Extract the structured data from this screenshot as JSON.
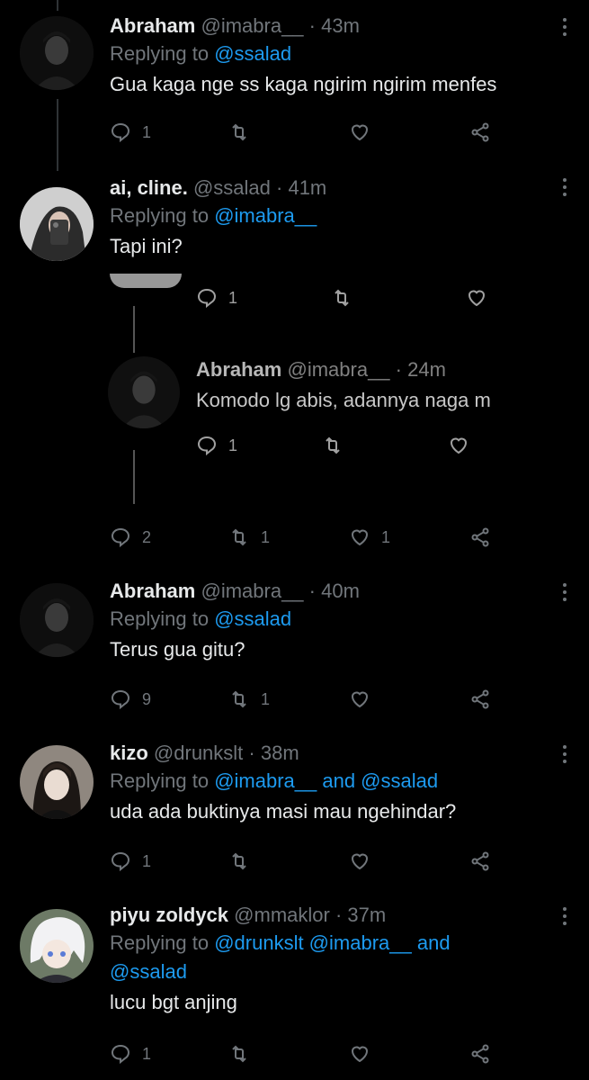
{
  "tweets": [
    {
      "name": "Abraham",
      "handle": "@imabra__",
      "time": "· 43m",
      "reply_prefix": "Replying to",
      "reply_to": "@ssalad",
      "text": "Gua kaga nge ss kaga ngirim ngirim menfes",
      "replies": "1",
      "retweets": "",
      "likes": ""
    },
    {
      "name": "ai, cline.",
      "handle": "@ssalad",
      "time": "· 41m",
      "reply_prefix": "Replying to",
      "reply_to": "@imabra__",
      "text": "Tapi ini?",
      "replies": "2",
      "retweets": "1",
      "likes": "1",
      "embedded": {
        "top_replies": "1",
        "quote_name": "Abraham",
        "quote_handle": "@imabra__",
        "quote_time": "· 24m",
        "quote_text": "Komodo lg abis, adannya naga m",
        "quote_replies": "1"
      }
    },
    {
      "name": "Abraham",
      "handle": "@imabra__",
      "time": "· 40m",
      "reply_prefix": "Replying to",
      "reply_to": "@ssalad",
      "text": "Terus gua gitu?",
      "replies": "9",
      "retweets": "1",
      "likes": ""
    },
    {
      "name": "kizo",
      "handle": "@drunkslt",
      "time": "· 38m",
      "reply_prefix": "Replying to",
      "reply_to": "@imabra__ and @ssalad",
      "text": "uda ada buktinya masi mau ngehindar?",
      "replies": "1",
      "retweets": "",
      "likes": ""
    },
    {
      "name": "piyu zoldyck",
      "handle": "@mmaklor",
      "time": "· 37m",
      "reply_prefix": "Replying to",
      "reply_to_line1": "@drunkslt @imabra__ and",
      "reply_to_line2": "@ssalad",
      "text": "lucu bgt anjing",
      "replies": "1",
      "retweets": "",
      "likes": ""
    }
  ]
}
